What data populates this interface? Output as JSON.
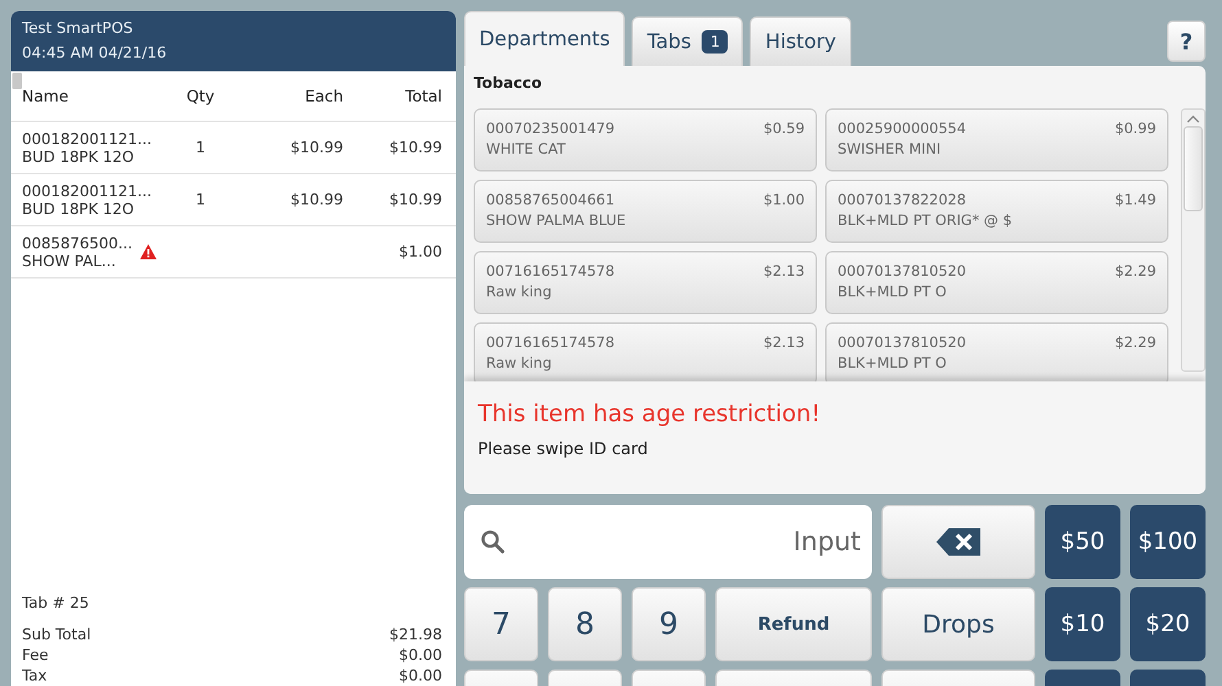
{
  "receipt": {
    "title": "Test SmartPOS",
    "datetime": "04:45 AM 04/21/16",
    "columns": [
      "Name",
      "Qty",
      "Each",
      "Total"
    ],
    "rows": [
      {
        "code": "000182001121...",
        "name": "BUD 18PK 12O",
        "qty": "1",
        "each": "$10.99",
        "total": "$10.99",
        "warning": false
      },
      {
        "code": "000182001121...",
        "name": "BUD 18PK 12O",
        "qty": "1",
        "each": "$10.99",
        "total": "$10.99",
        "warning": false
      },
      {
        "code": "0085876500...",
        "name": "SHOW PAL...",
        "total": "$1.00",
        "warning": true
      }
    ],
    "tab_label": "Tab # 25",
    "totals": [
      {
        "label": "Sub Total",
        "value": "$21.98"
      },
      {
        "label": "Fee",
        "value": "$0.00"
      },
      {
        "label": "Tax",
        "value": "$0.00"
      }
    ]
  },
  "tabs": [
    {
      "label": "Departments",
      "selected": true
    },
    {
      "label": "Tabs",
      "badge": "1",
      "selected": false
    },
    {
      "label": "History",
      "selected": false
    }
  ],
  "help_button": "?",
  "department": {
    "title": "Tobacco",
    "items": [
      {
        "code": "00070235001479",
        "price": "$0.59",
        "name": "WHITE CAT"
      },
      {
        "code": "00025900000554",
        "price": "$0.99",
        "name": "SWISHER MINI"
      },
      {
        "code": "00858765004661",
        "price": "$1.00",
        "name": "SHOW PALMA BLUE"
      },
      {
        "code": "00070137822028",
        "price": "$1.49",
        "name": "BLK+MLD PT ORIG* @ $"
      },
      {
        "code": "00716165174578",
        "price": "$2.13",
        "name": "Raw king"
      },
      {
        "code": "00070137810520",
        "price": "$2.29",
        "name": "BLK+MLD PT O"
      },
      {
        "code": "00716165174578",
        "price": "$2.13",
        "name": "Raw king"
      },
      {
        "code": "00070137810520",
        "price": "$2.29",
        "name": "BLK+MLD PT O"
      }
    ]
  },
  "alert": {
    "title": "This item has age restriction!",
    "message": "Please swipe ID card"
  },
  "keypad": [
    {
      "kind": "input",
      "placeholder": "Input"
    },
    {
      "kind": "backspace"
    },
    {
      "kind": "cash",
      "label": "$50"
    },
    {
      "kind": "cash",
      "label": "$100"
    },
    {
      "kind": "digit",
      "label": "7"
    },
    {
      "kind": "digit",
      "label": "8"
    },
    {
      "kind": "digit",
      "label": "9"
    },
    {
      "kind": "action",
      "label": "Refund"
    },
    {
      "kind": "command",
      "label": "Drops"
    },
    {
      "kind": "cash",
      "label": "$10"
    },
    {
      "kind": "cash",
      "label": "$20"
    },
    {
      "kind": "digit"
    },
    {
      "kind": "digit"
    },
    {
      "kind": "digit"
    },
    {
      "kind": "action"
    },
    {
      "kind": "command"
    },
    {
      "kind": "cash"
    },
    {
      "kind": "cash"
    }
  ]
}
